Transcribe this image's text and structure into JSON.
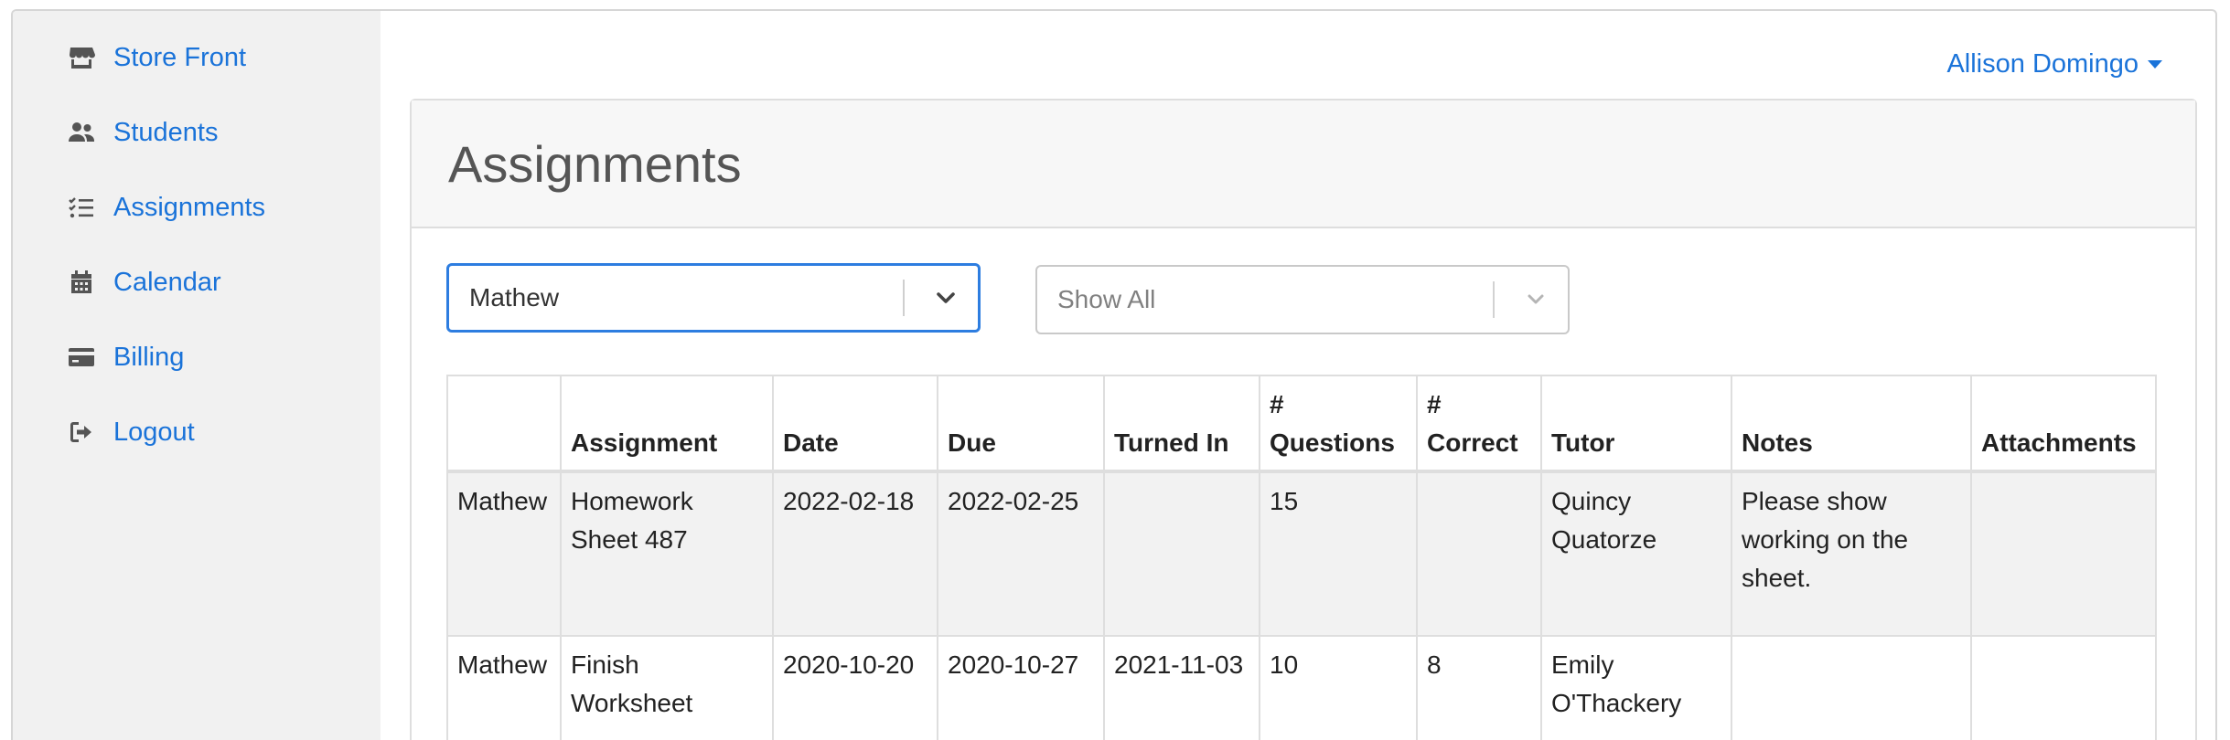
{
  "sidebar": {
    "items": [
      {
        "label": "Store Front",
        "icon": "store-icon"
      },
      {
        "label": "Students",
        "icon": "users-icon"
      },
      {
        "label": "Assignments",
        "icon": "tasks-icon"
      },
      {
        "label": "Calendar",
        "icon": "calendar-icon"
      },
      {
        "label": "Billing",
        "icon": "credit-card-icon"
      },
      {
        "label": "Logout",
        "icon": "sign-out-icon"
      }
    ]
  },
  "header": {
    "user_name": "Allison Domingo"
  },
  "card": {
    "title": "Assignments"
  },
  "filters": {
    "student_value": "Mathew",
    "status_placeholder": "Show All"
  },
  "table": {
    "headers": [
      "",
      "Assignment",
      "Date",
      "Due",
      "Turned In",
      "# Questions",
      "# Correct",
      "Tutor",
      "Notes",
      "Attachments"
    ],
    "rows": [
      [
        "Mathew",
        "Homework Sheet 487",
        "2022-02-18",
        "2022-02-25",
        "",
        "15",
        "",
        "Quincy Quatorze",
        "Please show working on the sheet.",
        ""
      ],
      [
        "Mathew",
        "Finish Worksheet",
        "2020-10-20",
        "2020-10-27",
        "2021-11-03",
        "10",
        "8",
        "Emily O'Thackery",
        "",
        ""
      ]
    ]
  },
  "colors": {
    "link": "#1a73d9",
    "sidebar_bg": "#f1f1f1",
    "focus_border": "#2d7de0"
  }
}
